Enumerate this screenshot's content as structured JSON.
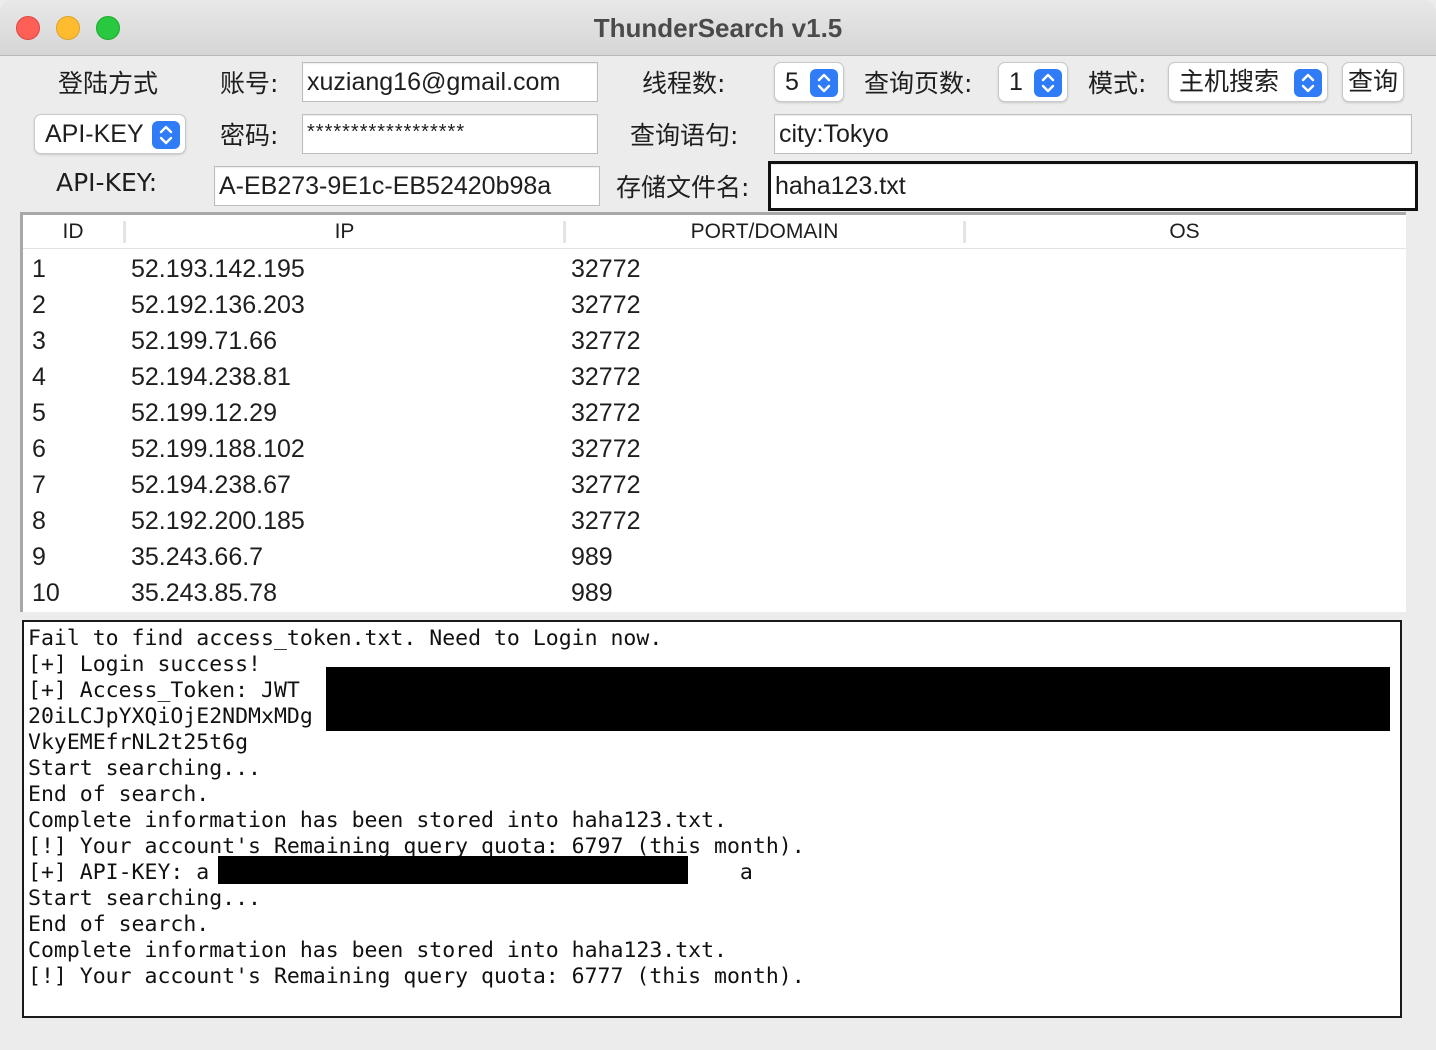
{
  "window": {
    "title": "ThunderSearch v1.5"
  },
  "form": {
    "login_method_label": "登陆方式",
    "login_method_value": "API-KEY",
    "account_label": "账号:",
    "account_value": "xuziang16@gmail.com",
    "password_label": "密码:",
    "password_value": "******************",
    "apikey_label": "API-KEY:",
    "apikey_value": "A-EB273-9E1c-EB52420b98a",
    "threads_label": "线程数:",
    "threads_value": "5",
    "pages_label": "查询页数:",
    "pages_value": "1",
    "mode_label": "模式:",
    "mode_value": "主机搜索",
    "query_button": "查询",
    "query_label": "查询语句:",
    "query_value": "city:Tokyo",
    "filename_label": "存储文件名:",
    "filename_value": "haha123.txt"
  },
  "table": {
    "columns": [
      "ID",
      "IP",
      "PORT/DOMAIN",
      "OS"
    ],
    "rows": [
      {
        "id": "1",
        "ip": "52.193.142.195",
        "port": "32772",
        "os": ""
      },
      {
        "id": "2",
        "ip": "52.192.136.203",
        "port": "32772",
        "os": ""
      },
      {
        "id": "3",
        "ip": "52.199.71.66",
        "port": "32772",
        "os": ""
      },
      {
        "id": "4",
        "ip": "52.194.238.81",
        "port": "32772",
        "os": ""
      },
      {
        "id": "5",
        "ip": "52.199.12.29",
        "port": "32772",
        "os": ""
      },
      {
        "id": "6",
        "ip": "52.199.188.102",
        "port": "32772",
        "os": ""
      },
      {
        "id": "7",
        "ip": "52.194.238.67",
        "port": "32772",
        "os": ""
      },
      {
        "id": "8",
        "ip": "52.192.200.185",
        "port": "32772",
        "os": ""
      },
      {
        "id": "9",
        "ip": "35.243.66.7",
        "port": "989",
        "os": ""
      },
      {
        "id": "10",
        "ip": "35.243.85.78",
        "port": "989",
        "os": ""
      }
    ]
  },
  "log": {
    "lines": [
      "Fail to find access_token.txt. Need to Login now.",
      "[+] Login success!",
      "[+] Access_Token: JWT",
      "20iLCJpYXQiOjE2NDMxMDg",
      "VkyEMEfrNL2t25t6g",
      "Start searching...",
      "End of search.",
      "Complete information has been stored into haha123.txt.",
      "[!] Your account's Remaining query quota: 6797 (this month).",
      "[+] API-KEY: a                                         a",
      "Start searching...",
      "End of search.",
      "Complete information has been stored into haha123.txt.",
      "[!] Your account's Remaining query quota: 6777 (this month)."
    ]
  }
}
